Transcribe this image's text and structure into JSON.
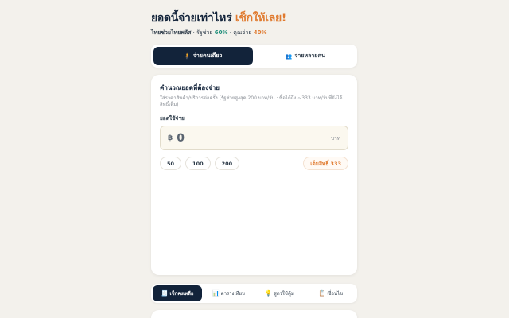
{
  "header": {
    "title_main": "ยอดนี้จ่ายเท่าไหร่",
    "title_accent": "เช็กให้เลย!",
    "sub_brand": "ไทยช่วยไทยพลัส",
    "sub_gov_label": "· รัฐช่วย",
    "sub_gov_pct": "60%",
    "sub_you_label": "· คุณจ่าย",
    "sub_you_pct": "40%"
  },
  "mode": {
    "single_label": "จ่ายคนเดียว",
    "single_icon": "person-icon",
    "group_label": "จ่ายหลายคน",
    "group_icon": "people-icon"
  },
  "calculator": {
    "title": "คำนวณยอดที่ต้องจ่าย",
    "desc": "ใส่ราคาสินค้า/บริการต่อครั้ง (รัฐช่วยสูงสุด 200 บาท/วัน · ซื้อได้ถึง ~333 บาท/วันที่ยังได้สิทธิ์เต็ม)",
    "amount_label": "ยอดใช้จ่าย",
    "currency_symbol": "฿",
    "amount_value": "0",
    "unit": "บาท",
    "quick_amounts": [
      "50",
      "100",
      "200"
    ],
    "max_chip": "เต็มสิทธิ์ 333"
  },
  "tabs": [
    {
      "label": "เช็กคงเหลือ",
      "icon": "checklist-icon",
      "active": true
    },
    {
      "label": "ตารางเทียบ",
      "icon": "bar-chart-icon",
      "active": false
    },
    {
      "label": "สูตรใช้คุ้ม",
      "icon": "lightbulb-icon",
      "active": false
    },
    {
      "label": "เงื่อนไข",
      "icon": "clipboard-icon",
      "active": false
    }
  ],
  "colors": {
    "navy": "#12233a",
    "accent_orange": "#e07a2f",
    "accent_green": "#1f8f7a",
    "background": "#f3f1ec"
  }
}
